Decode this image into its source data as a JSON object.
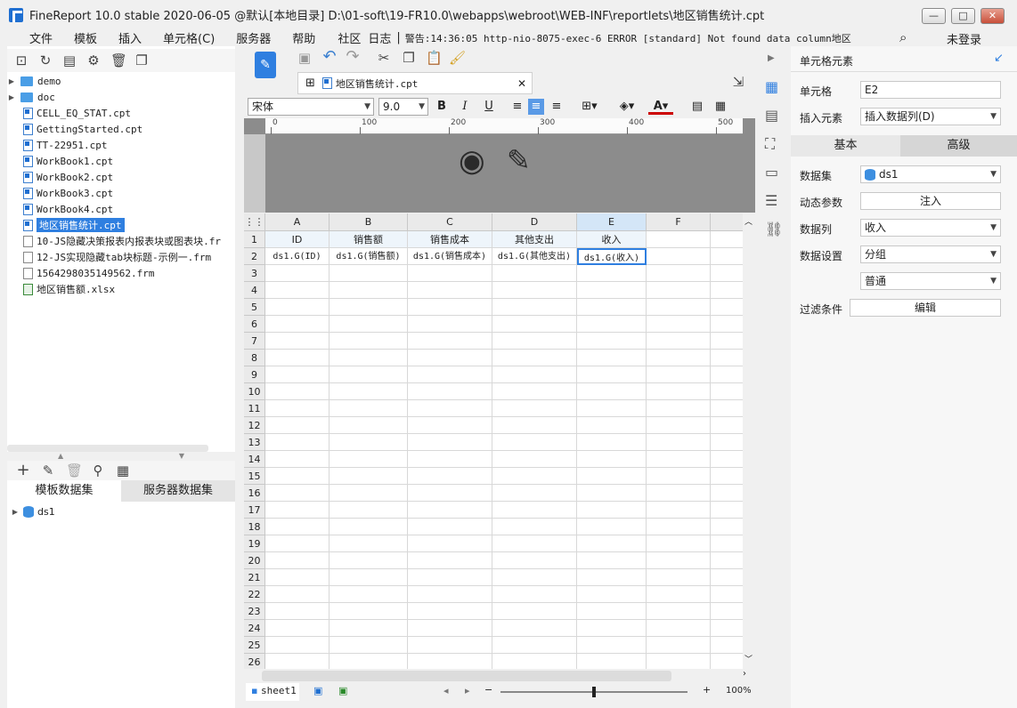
{
  "window": {
    "title": "FineReport 10.0 stable 2020-06-05 @默认[本地目录]    D:\\01-soft\\19-FR10.0\\webapps\\webroot\\WEB-INF\\reportlets\\地区销售统计.cpt",
    "min_icon": "minimize-icon",
    "max_icon": "maximize-icon",
    "close_icon": "close-icon"
  },
  "menu": {
    "items": [
      "文件",
      "模板",
      "插入",
      "单元格(C)",
      "服务器",
      "帮助",
      "社区"
    ],
    "log_label": "日志",
    "log_text": "警告:14:36:05 http-nio-8075-exec-6 ERROR [standard] Not found data column地区",
    "login": "未登录"
  },
  "tree": {
    "items": [
      {
        "label": "demo",
        "type": "folder"
      },
      {
        "label": "doc",
        "type": "folder"
      },
      {
        "label": "CELL_EQ_STAT.cpt",
        "type": "cpt"
      },
      {
        "label": "GettingStarted.cpt",
        "type": "cpt"
      },
      {
        "label": "TT-22951.cpt",
        "type": "cpt"
      },
      {
        "label": "WorkBook1.cpt",
        "type": "cpt"
      },
      {
        "label": "WorkBook2.cpt",
        "type": "cpt"
      },
      {
        "label": "WorkBook3.cpt",
        "type": "cpt"
      },
      {
        "label": "WorkBook4.cpt",
        "type": "cpt"
      },
      {
        "label": "地区销售统计.cpt",
        "type": "cpt"
      },
      {
        "label": "10-JS隐藏决策报表内报表块或图表块.fr",
        "type": "frm"
      },
      {
        "label": "12-JS实现隐藏tab块标题-示例一.frm",
        "type": "frm"
      },
      {
        "label": "1564298035149562.frm",
        "type": "frm"
      },
      {
        "label": "地区销售额.xlsx",
        "type": "xls"
      }
    ]
  },
  "datasets": {
    "tab_template": "模板数据集",
    "tab_server": "服务器数据集",
    "items": [
      "ds1"
    ]
  },
  "editor": {
    "file_tab": "地区销售统计.cpt",
    "font_name": "宋体",
    "font_size": "9.0",
    "ruler_labels": [
      "0",
      "100",
      "200",
      "300",
      "400",
      "500"
    ],
    "columns": [
      "A",
      "B",
      "C",
      "D",
      "E",
      "F"
    ],
    "row_count": 26,
    "row1": [
      "ID",
      "销售额",
      "销售成本",
      "其他支出",
      "收入"
    ],
    "row2": [
      "ds1.G(ID)",
      "ds1.G(销售额)",
      "ds1.G(销售成本)",
      "ds1.G(其他支出)",
      "ds1.G(收入)"
    ],
    "sheet": "sheet1",
    "zoom": "100%"
  },
  "cell_panel": {
    "header": "单元格元素",
    "cell_label": "单元格",
    "cell_value": "E2",
    "insert_label": "插入元素",
    "insert_value": "插入数据列(D)",
    "tab_basic": "基本",
    "tab_advanced": "高级",
    "dataset_label": "数据集",
    "dataset_value": "ds1",
    "param_label": "动态参数",
    "param_button": "注入",
    "column_label": "数据列",
    "column_value": "收入",
    "setting_label": "数据设置",
    "setting_value": "分组",
    "setting_value2": "普通",
    "filter_label": "过滤条件",
    "filter_button": "编辑"
  }
}
